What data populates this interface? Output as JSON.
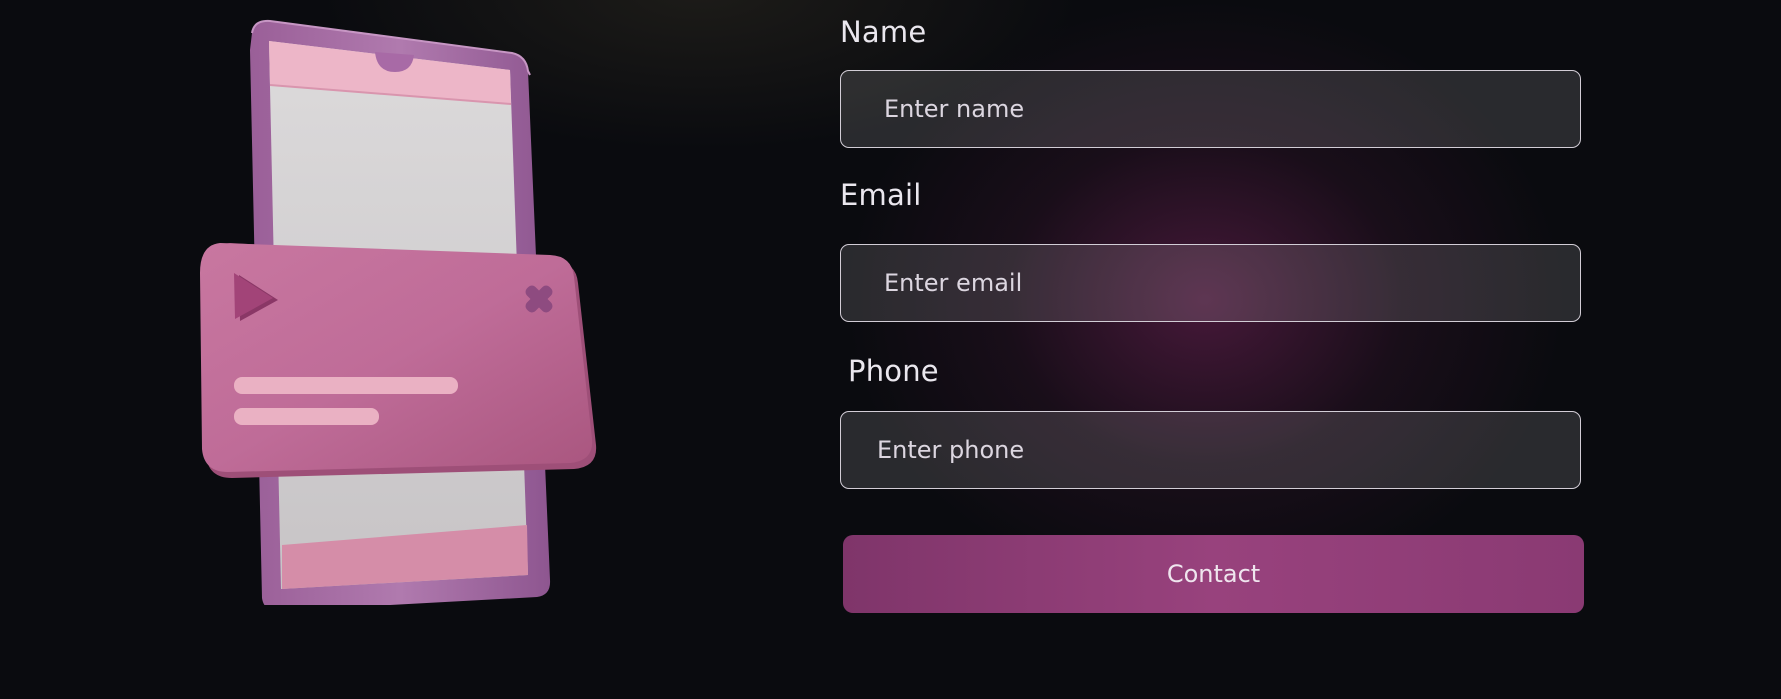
{
  "form": {
    "name_label": "Name",
    "name_placeholder": "Enter name",
    "email_label": "Email",
    "email_placeholder": "Enter email",
    "phone_label": "Phone",
    "phone_placeholder": "Enter phone",
    "submit_label": "Contact"
  },
  "illustration": {
    "icons": [
      "phone-icon",
      "play-icon",
      "close-icon"
    ]
  },
  "colors": {
    "background": "#0a0b0f",
    "glow": "#78245c",
    "button": "#98427d",
    "input_border": "#d2cdd6",
    "phone_body": "#a86aa6",
    "card": "#c06d9a"
  }
}
